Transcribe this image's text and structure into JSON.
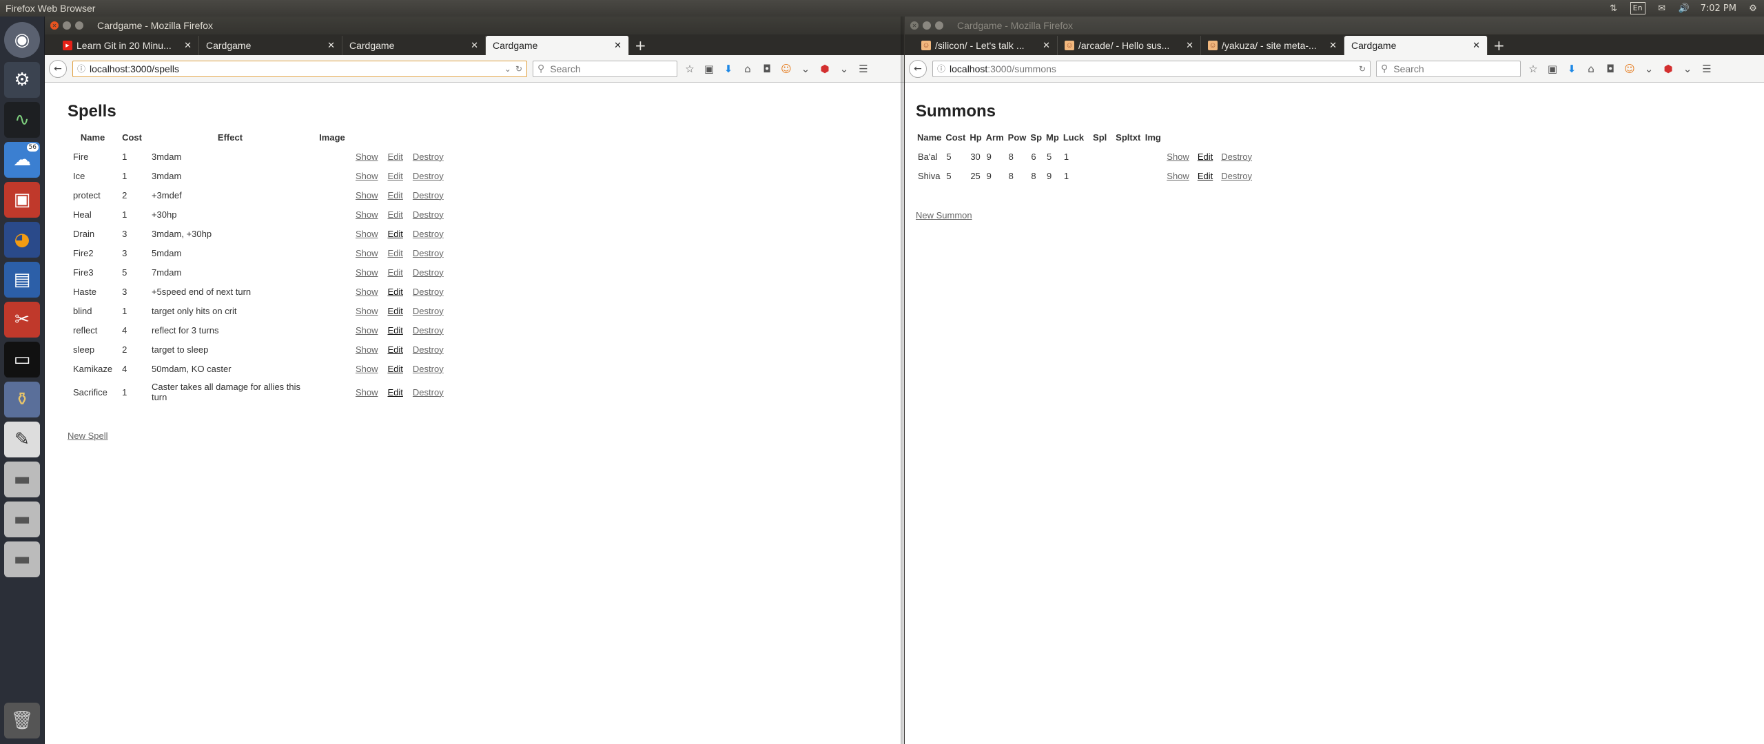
{
  "top_panel": {
    "app_title": "Firefox Web Browser",
    "keyboard_layout": "En",
    "time": "7:02 PM"
  },
  "launcher": {
    "badge_count": "56"
  },
  "left_window": {
    "title": "Cardgame - Mozilla Firefox",
    "tabs": [
      {
        "label": "Learn Git in 20 Minu..."
      },
      {
        "label": "Cardgame"
      },
      {
        "label": "Cardgame"
      },
      {
        "label": "Cardgame"
      }
    ],
    "url": "localhost:3000/spells",
    "search_placeholder": "Search",
    "page": {
      "heading": "Spells",
      "columns": [
        "Name",
        "Cost",
        "Effect",
        "Image"
      ],
      "rows": [
        {
          "name": "Fire",
          "cost": "1",
          "effect": "3mdam"
        },
        {
          "name": "Ice",
          "cost": "1",
          "effect": "3mdam"
        },
        {
          "name": "protect",
          "cost": "2",
          "effect": "+3mdef"
        },
        {
          "name": "Heal",
          "cost": "1",
          "effect": "+30hp"
        },
        {
          "name": "Drain",
          "cost": "3",
          "effect": "3mdam, +30hp"
        },
        {
          "name": "Fire2",
          "cost": "3",
          "effect": "5mdam"
        },
        {
          "name": "Fire3",
          "cost": "5",
          "effect": "7mdam"
        },
        {
          "name": "Haste",
          "cost": "3",
          "effect": "+5speed end of next turn"
        },
        {
          "name": "blind",
          "cost": "1",
          "effect": "target only hits on crit"
        },
        {
          "name": "reflect",
          "cost": "4",
          "effect": "reflect for 3 turns"
        },
        {
          "name": "sleep",
          "cost": "2",
          "effect": "target to sleep"
        },
        {
          "name": "Kamikaze",
          "cost": "4",
          "effect": "50mdam, KO caster"
        },
        {
          "name": "Sacrifice",
          "cost": "1",
          "effect": "Caster takes all damage for allies this turn"
        }
      ],
      "actions": {
        "show": "Show",
        "edit": "Edit",
        "destroy": "Destroy"
      },
      "new_link": "New Spell"
    }
  },
  "right_window": {
    "title": "Cardgame - Mozilla Firefox",
    "tabs": [
      {
        "label": "/silicon/ - Let's talk ..."
      },
      {
        "label": "/arcade/ - Hello sus..."
      },
      {
        "label": "/yakuza/ - site meta-..."
      },
      {
        "label": "Cardgame"
      }
    ],
    "url_host": "localhost",
    "url_path": ":3000/summons",
    "search_placeholder": "Search",
    "page": {
      "heading": "Summons",
      "columns": [
        "Name",
        "Cost",
        "Hp",
        "Arm",
        "Pow",
        "Sp",
        "Mp",
        "Luck",
        "Spl",
        "Spltxt",
        "Img"
      ],
      "rows": [
        {
          "name": "Ba'al",
          "cost": "5",
          "hp": "30",
          "arm": "9",
          "pow": "8",
          "sp": "6",
          "mp": "5",
          "luck": "1"
        },
        {
          "name": "Shiva",
          "cost": "5",
          "hp": "25",
          "arm": "9",
          "pow": "8",
          "sp": "8",
          "mp": "9",
          "luck": "1"
        }
      ],
      "actions": {
        "show": "Show",
        "edit": "Edit",
        "destroy": "Destroy"
      },
      "new_link": "New Summon"
    }
  }
}
